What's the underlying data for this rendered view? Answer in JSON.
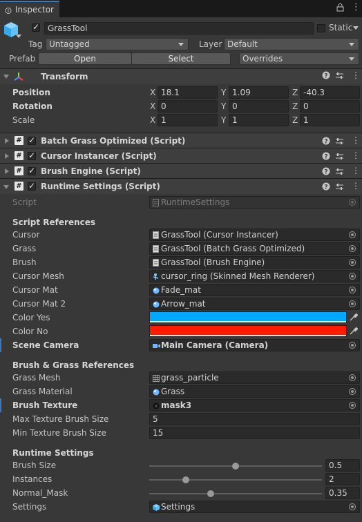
{
  "tab": {
    "label": "Inspector"
  },
  "object": {
    "name": "GrassTool",
    "static_label": "Static",
    "tag_label": "Tag",
    "tag_value": "Untagged",
    "layer_label": "Layer",
    "layer_value": "Default",
    "prefab_label": "Prefab",
    "open_label": "Open",
    "select_label": "Select",
    "overrides_label": "Overrides"
  },
  "transform": {
    "title": "Transform",
    "position_label": "Position",
    "rotation_label": "Rotation",
    "scale_label": "Scale",
    "position": {
      "x": "18.1",
      "y": "1.09",
      "z": "-40.3"
    },
    "rotation": {
      "x": "0",
      "y": "0",
      "z": "0"
    },
    "scale": {
      "x": "1",
      "y": "1",
      "z": "1"
    },
    "axis_x": "X",
    "axis_y": "Y",
    "axis_z": "Z"
  },
  "components": [
    {
      "title": "Batch Grass Optimized (Script)"
    },
    {
      "title": "Cursor Instancer (Script)"
    },
    {
      "title": "Brush Engine (Script)"
    },
    {
      "title": "Runtime Settings (Script)"
    }
  ],
  "runtime": {
    "script_label": "Script",
    "script_value": "RuntimeSettings",
    "script_refs_title": "Script References",
    "fields": [
      {
        "label": "Cursor",
        "value": "GrassTool (Cursor Instancer)"
      },
      {
        "label": "Grass",
        "value": "GrassTool (Batch Grass Optimized)"
      },
      {
        "label": "Brush",
        "value": "GrassTool (Brush Engine)"
      },
      {
        "label": "Cursor Mesh",
        "value": "cursor_ring (Skinned Mesh Renderer)"
      },
      {
        "label": "Cursor Mat",
        "value": "Fade_mat"
      },
      {
        "label": "Cursor Mat 2",
        "value": "Arrow_mat"
      }
    ],
    "color_yes_label": "Color Yes",
    "color_yes": "#00a8ff",
    "color_no_label": "Color No",
    "color_no": "#ff1a00",
    "scene_camera_label": "Scene Camera",
    "scene_camera_value": "Main Camera (Camera)",
    "brush_refs_title": "Brush & Grass References",
    "grass_mesh_label": "Grass Mesh",
    "grass_mesh_value": "grass_particle",
    "grass_material_label": "Grass Material",
    "grass_material_value": "Grass",
    "brush_texture_label": "Brush Texture",
    "brush_texture_value": "mask3",
    "max_tex_label": "Max Texture Brush Size",
    "max_tex_value": "5",
    "min_tex_label": "Min Texture Brush Size",
    "min_tex_value": "15",
    "runtime_title": "Runtime Settings",
    "brush_size_label": "Brush Size",
    "brush_size_value": "0.5",
    "brush_size_fill": 0.5,
    "instances_label": "Instances",
    "instances_value": "2",
    "instances_fill": 0.2,
    "normal_mask_label": "Normal_Mask",
    "normal_mask_value": "0.35",
    "normal_mask_fill": 0.35,
    "settings_label": "Settings",
    "settings_value": "Settings"
  }
}
